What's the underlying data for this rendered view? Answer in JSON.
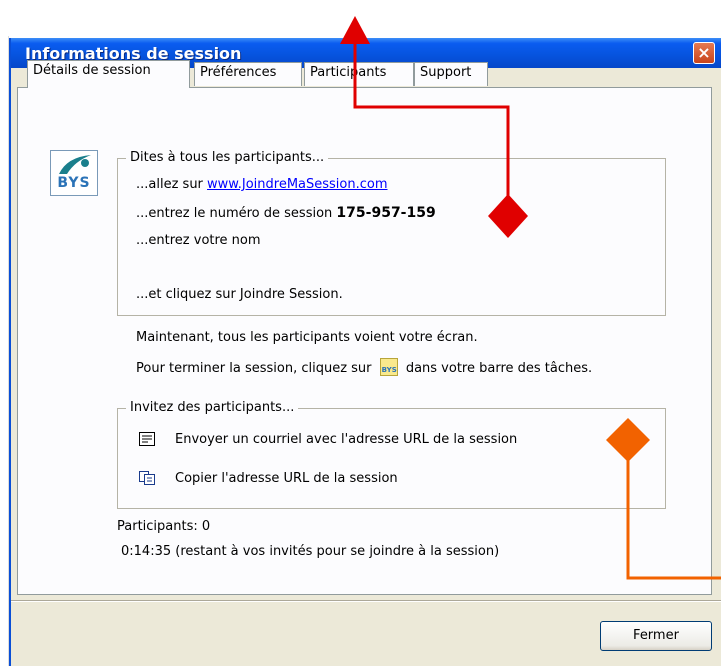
{
  "window": {
    "title": "Informations de session",
    "close_label": "×"
  },
  "tabs": [
    {
      "label": "Détails de session",
      "active": true
    },
    {
      "label": "Préférences",
      "active": false
    },
    {
      "label": "Participants",
      "active": false
    },
    {
      "label": "Support",
      "active": false
    }
  ],
  "logo": {
    "text": "BYS",
    "icon": "bys-logo-icon"
  },
  "tell_group": {
    "legend": "Dites à tous les participants...",
    "line1_prefix": "...allez sur ",
    "line1_link": "www.JoindreMaSession.com",
    "line2_prefix": "...entrez le numéro de session  ",
    "session_number": "175-957-159",
    "line3": "...entrez votre nom",
    "line4": "...et cliquez sur Joindre Session."
  },
  "info": {
    "line1": "Maintenant, tous les participants voient votre écran.",
    "line2_prefix": "Pour terminer la session, cliquez sur",
    "line2_icon_text": "BYS",
    "line2_suffix": "dans votre barre des tâches."
  },
  "invite_group": {
    "legend": "Invitez des participants...",
    "email_label": "Envoyer un courriel avec l'adresse URL de la session",
    "copy_label": "Copier l'adresse URL de la session"
  },
  "status": {
    "participants": "Participants:  0",
    "time": "0:14:35 (restant à vos invités pour se joindre à la session)"
  },
  "buttons": {
    "close": "Fermer"
  },
  "colors": {
    "annotation_red": "#e00000",
    "annotation_orange": "#f26200",
    "title_blue": "#0653dd"
  }
}
